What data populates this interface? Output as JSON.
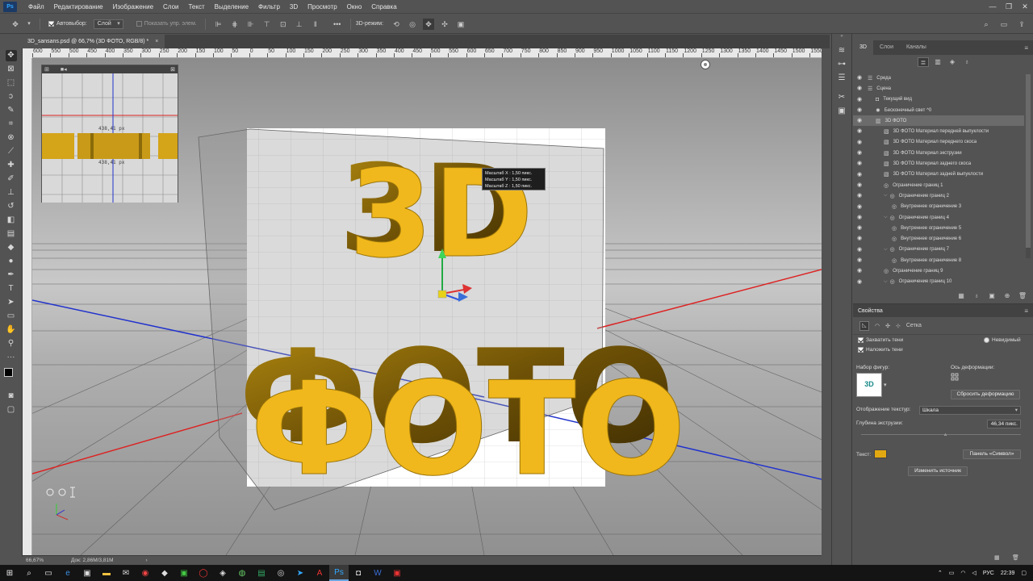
{
  "menubar": {
    "logo": "Ps",
    "items": [
      "Файл",
      "Редактирование",
      "Изображение",
      "Слои",
      "Текст",
      "Выделение",
      "Фильтр",
      "3D",
      "Просмотр",
      "Окно",
      "Справка"
    ]
  },
  "optionsbar": {
    "autoselect_label": "Автовыбор:",
    "autoselect_value": "Слой",
    "show_controls_label": "Показать упр. элем.",
    "mode3d_label": "3D-режим:"
  },
  "document": {
    "tab_title": "3D_sansans.psd @ 66,7% (3D ФОТО, RGB/8) *",
    "zoom": "66,67%",
    "doc_size": "Док: 2,86M/3,81M"
  },
  "ruler_top_labels": [
    "600",
    "550",
    "500",
    "450",
    "400",
    "350",
    "300",
    "250",
    "200",
    "150",
    "100",
    "50",
    "0",
    "50",
    "100",
    "150",
    "200",
    "250",
    "300",
    "350",
    "400",
    "450",
    "500",
    "550",
    "600",
    "650",
    "700",
    "750",
    "800",
    "850",
    "900",
    "950",
    "1000",
    "1050",
    "1100",
    "1150",
    "1200",
    "1250",
    "1300",
    "1350",
    "1400",
    "1450",
    "1500",
    "1550"
  ],
  "navigator": {
    "measure_top": "438,41 px",
    "measure_bottom": "438,41 px"
  },
  "canvas": {
    "text_top": "3D",
    "text_bottom": "ФОТО",
    "tooltip_lines": [
      "Масштаб X :  1,50 пикс.",
      "Масштаб Y :  1,50 пикс.",
      "Масштаб Z :  1,50 пикс."
    ]
  },
  "panel3d": {
    "tabs": [
      "3D",
      "Слои",
      "Каналы"
    ],
    "tree": [
      {
        "label": "Среда",
        "indent": 0,
        "icon": "env"
      },
      {
        "label": "Сцена",
        "indent": 0,
        "icon": "scene"
      },
      {
        "label": "Текущий вид",
        "indent": 1,
        "icon": "camera"
      },
      {
        "label": "Бесконечный свет ^0",
        "indent": 1,
        "icon": "light"
      },
      {
        "label": "3D ФОТО",
        "indent": 1,
        "icon": "mesh",
        "selected": true
      },
      {
        "label": "3D ФОТО Материал передней выпуклости",
        "indent": 2,
        "icon": "material"
      },
      {
        "label": "3D ФОТО Материал переднего скоса",
        "indent": 2,
        "icon": "material"
      },
      {
        "label": "3D ФОТО Материал экструзии",
        "indent": 2,
        "icon": "material"
      },
      {
        "label": "3D ФОТО Материал заднего скоса",
        "indent": 2,
        "icon": "material"
      },
      {
        "label": "3D ФОТО Материал задней выпуклости",
        "indent": 2,
        "icon": "material"
      },
      {
        "label": "Ограничение границ 1",
        "indent": 2,
        "icon": "constraint"
      },
      {
        "label": "Ограничение границ 2",
        "indent": 2,
        "icon": "constraint",
        "expanded": true
      },
      {
        "label": "Внутреннее ограничение 3",
        "indent": 3,
        "icon": "constraint"
      },
      {
        "label": "Ограничение границ 4",
        "indent": 2,
        "icon": "constraint",
        "expanded": true
      },
      {
        "label": "Внутреннее ограничение 5",
        "indent": 3,
        "icon": "constraint"
      },
      {
        "label": "Внутреннее ограничение 6",
        "indent": 3,
        "icon": "constraint"
      },
      {
        "label": "Ограничение границ 7",
        "indent": 2,
        "icon": "constraint",
        "expanded": true
      },
      {
        "label": "Внутреннее ограничение 8",
        "indent": 3,
        "icon": "constraint"
      },
      {
        "label": "Ограничение границ 9",
        "indent": 2,
        "icon": "constraint"
      },
      {
        "label": "Ограничение границ 10",
        "indent": 2,
        "icon": "constraint",
        "expanded": true
      }
    ]
  },
  "properties": {
    "title": "Свойства",
    "tab_mesh_label": "Сетка",
    "catch_shadows": "Захватить тени",
    "cast_shadows": "Наложить тени",
    "invisible": "Невидимый",
    "shape_preset": "Набор фигур:",
    "deform_axis": "Ось деформации:",
    "reset_deform": "Сбросить деформацию",
    "texture_map_label": "Отображение текстур:",
    "texture_map_value": "Шкала",
    "extrusion_depth_label": "Глубина экструзии:",
    "extrusion_depth_value": "46,34 пикс.",
    "text_label": "Текст:",
    "char_panel": "Панель «Символ»",
    "change_source": "Изменить источник",
    "shape_thumb_text": "3D"
  },
  "taskbar": {
    "lang": "РУС",
    "time": "22:39"
  },
  "colors": {
    "gold": "#f0b81c",
    "accent": "#31a8ff"
  }
}
